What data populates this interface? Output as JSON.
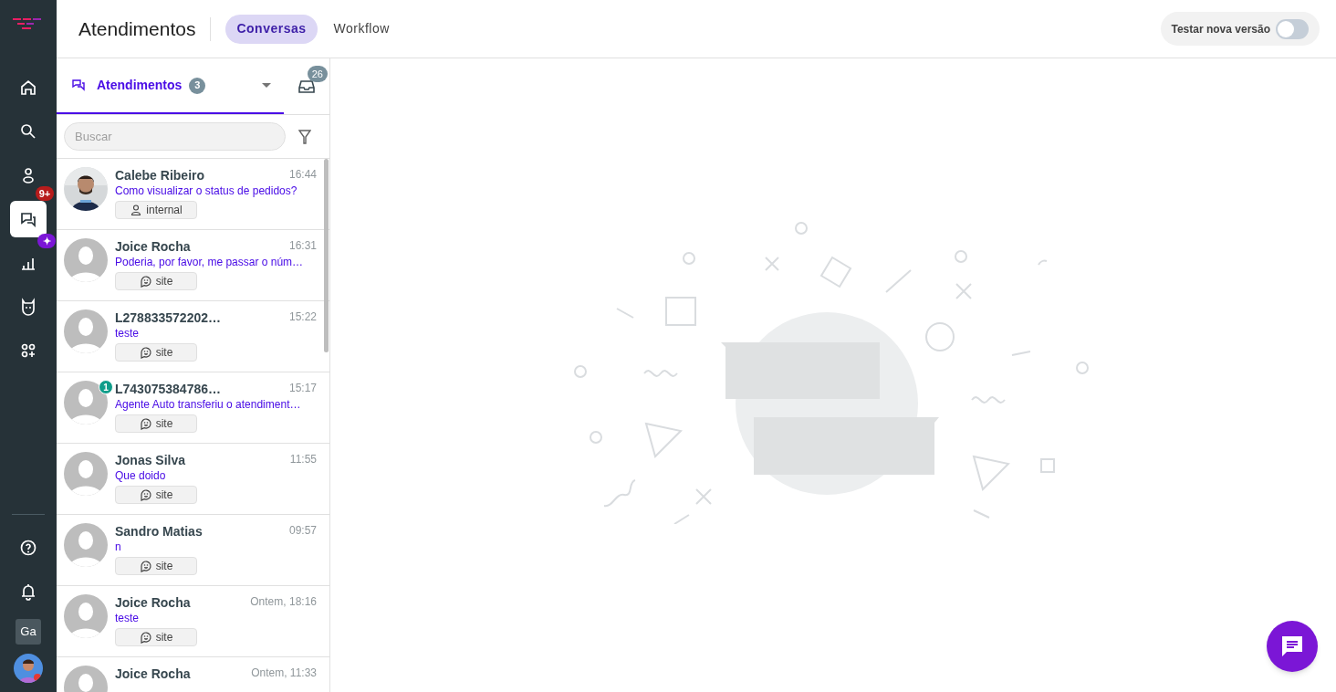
{
  "sidebar": {
    "items": [
      {
        "kind": "home",
        "selected": false
      },
      {
        "kind": "search",
        "selected": false
      },
      {
        "kind": "contacts",
        "selected": false
      },
      {
        "kind": "chats",
        "selected": true,
        "badge": "9+"
      },
      {
        "kind": "reports",
        "selected": false,
        "badge": "✦"
      },
      {
        "kind": "bot",
        "selected": false
      },
      {
        "kind": "apps",
        "selected": false
      }
    ],
    "bottom": [
      {
        "kind": "help"
      },
      {
        "kind": "notifications"
      },
      {
        "kind": "workspace",
        "label": "Ga"
      },
      {
        "kind": "avatar"
      }
    ]
  },
  "header": {
    "title": "Atendimentos",
    "tabs": [
      {
        "label": "Conversas",
        "selected": true
      },
      {
        "label": "Workflow",
        "selected": false
      }
    ],
    "toggle": {
      "label": "Testar nova versão",
      "on": false
    }
  },
  "list_panel": {
    "tab": {
      "label": "Atendimentos",
      "count": "3"
    },
    "inbox_count": "26",
    "search": {
      "placeholder": "Buscar"
    },
    "conversations": [
      {
        "name": "Calebe Ribeiro",
        "time": "16:44",
        "preview": "Como visualizar o status de pedidos?",
        "channel": {
          "kind": "internal",
          "label": "internal"
        },
        "photo": true
      },
      {
        "name": "Joice Rocha",
        "time": "16:31",
        "preview": "Poderia, por favor, me passar o núm…",
        "channel": {
          "kind": "site",
          "label": "site"
        },
        "photo": false
      },
      {
        "name": "L278833572202…",
        "time": "15:22",
        "preview": "teste",
        "channel": {
          "kind": "site",
          "label": "site"
        },
        "photo": false
      },
      {
        "name": "L743075384786…",
        "time": "15:17",
        "preview": "Agente Auto transferiu o atendiment…",
        "channel": {
          "kind": "site",
          "label": "site"
        },
        "photo": false,
        "unread": "1"
      },
      {
        "name": "Jonas Silva",
        "time": "11:55",
        "preview": "Que doido",
        "channel": {
          "kind": "site",
          "label": "site"
        },
        "photo": false
      },
      {
        "name": "Sandro Matias",
        "time": "09:57",
        "preview": "n",
        "channel": {
          "kind": "site",
          "label": "site"
        },
        "photo": false
      },
      {
        "name": "Joice Rocha",
        "time": "Ontem, 18:16",
        "preview": "teste",
        "channel": {
          "kind": "site",
          "label": "site"
        },
        "photo": false
      },
      {
        "name": "Joice Rocha",
        "time": "Ontem, 11:33",
        "photo": false
      }
    ]
  }
}
